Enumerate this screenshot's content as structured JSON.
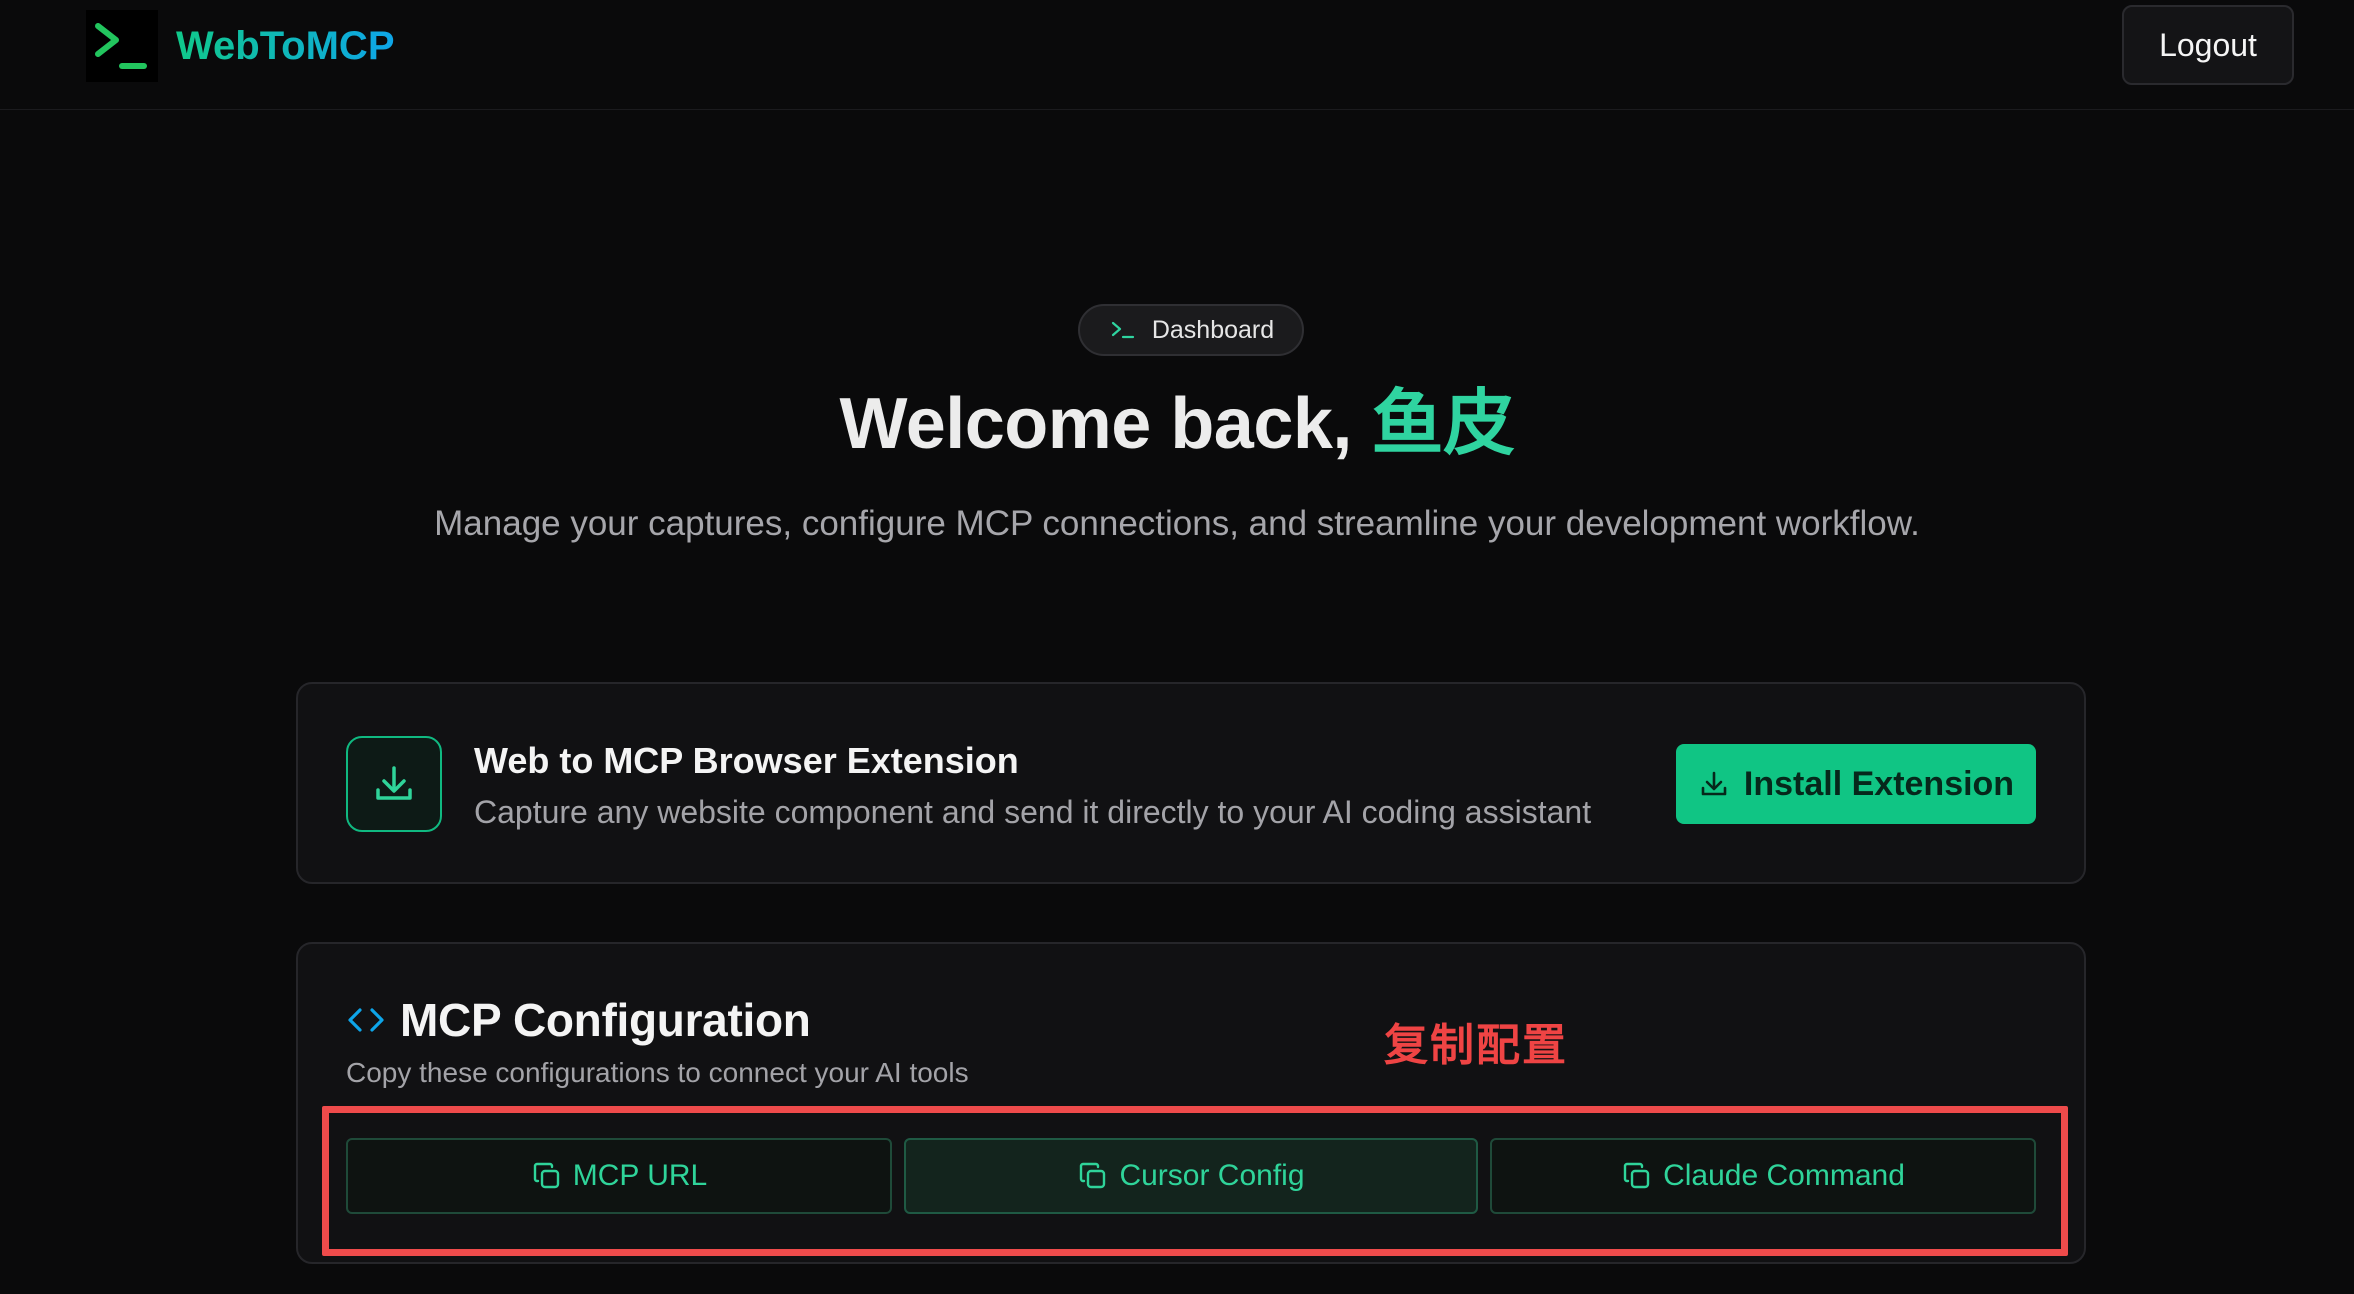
{
  "navbar": {
    "brand_name": "WebToMCP",
    "logo_icon": "terminal-prompt-icon",
    "logout_label": "Logout"
  },
  "hero": {
    "badge_label": "Dashboard",
    "badge_icon": "terminal-prompt-icon",
    "title_prefix": "Welcome back, ",
    "username": "鱼皮",
    "subtitle": "Manage your captures, configure MCP connections, and streamline your development workflow."
  },
  "extension": {
    "icon": "download-icon",
    "title": "Web to MCP Browser Extension",
    "description": "Capture any website component and send it directly to your AI coding assistant",
    "install_label": "Install Extension"
  },
  "config": {
    "icon": "code-brackets-icon",
    "title": "MCP Configuration",
    "description": "Copy these configurations to connect your AI tools",
    "annotation": "复制配置",
    "buttons": [
      {
        "label": "MCP URL",
        "icon": "copy-icon"
      },
      {
        "label": "Cursor Config",
        "icon": "copy-icon"
      },
      {
        "label": "Claude Command",
        "icon": "copy-icon"
      }
    ]
  },
  "colors": {
    "background": "#0a0a0b",
    "accent_green": "#10c584",
    "accent_blue": "#0ea5e9",
    "annotation_red": "#ef4444",
    "card_bg": "#111113"
  }
}
